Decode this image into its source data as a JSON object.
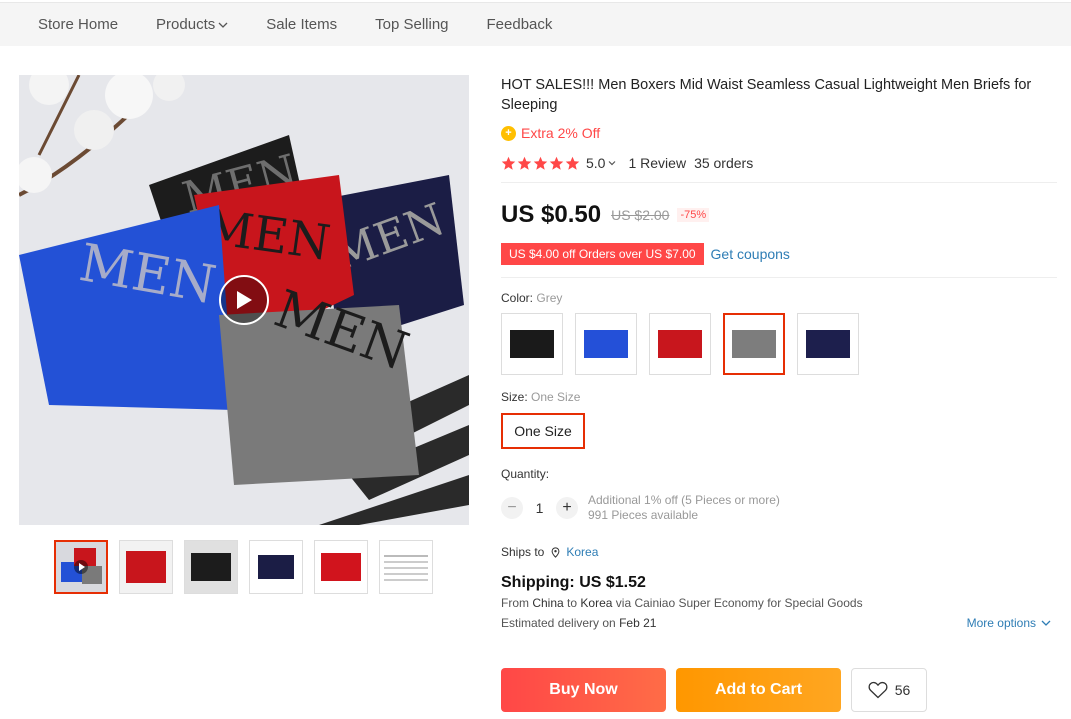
{
  "nav": {
    "items": [
      "Store Home",
      "Products",
      "Sale Items",
      "Top Selling",
      "Feedback"
    ]
  },
  "product": {
    "title": "HOT SALES!!! Men Boxers Mid Waist Seamless Casual Lightweight Men Briefs for Sleeping",
    "extra_off": "Extra 2% Off",
    "rating": "5.0",
    "reviews": "1 Review",
    "orders": "35 orders",
    "stars": 5,
    "price": "US $0.50",
    "original_price": "US $2.00",
    "discount": "-75%",
    "coupon": "US $4.00 off Orders over US $7.00",
    "get_coupons": "Get coupons"
  },
  "color": {
    "label": "Color:",
    "selected": "Grey",
    "options": [
      {
        "name": "black",
        "hex": "#1a1a1a"
      },
      {
        "name": "blue",
        "hex": "#2450d8"
      },
      {
        "name": "red",
        "hex": "#c8161d"
      },
      {
        "name": "grey",
        "hex": "#7d7d7d"
      },
      {
        "name": "navy",
        "hex": "#1d1f4d"
      }
    ]
  },
  "size": {
    "label": "Size:",
    "selected": "One Size",
    "option": "One Size"
  },
  "quantity": {
    "label": "Quantity:",
    "value": "1",
    "note1": "Additional 1% off (5 Pieces or more)",
    "note2": "991 Pieces available"
  },
  "shipping": {
    "ships_to": "Ships to",
    "country": "Korea",
    "cost": "Shipping: US $1.52",
    "route_prefix": "From",
    "from": "China",
    "to_word": "to",
    "to": "Korea",
    "via": "via Cainiao Super Economy for Special Goods",
    "delivery_prefix": "Estimated delivery on",
    "delivery_date": "Feb 21",
    "more_options": "More options"
  },
  "actions": {
    "buy_now": "Buy Now",
    "add_to_cart": "Add to Cart",
    "wishlist_count": "56"
  },
  "thumbnails": [
    "main-video",
    "red",
    "black",
    "navy",
    "red-alt",
    "size-chart"
  ]
}
